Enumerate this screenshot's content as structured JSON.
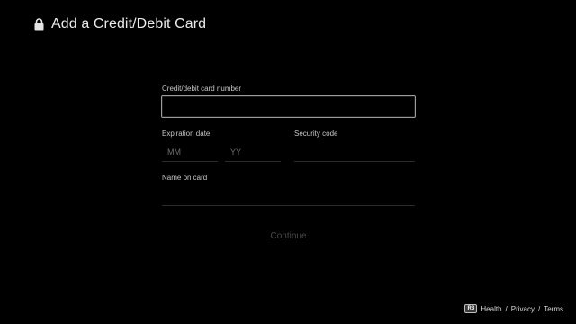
{
  "header": {
    "title": "Add a Credit/Debit Card",
    "icon": "lock-icon"
  },
  "form": {
    "card_number": {
      "label": "Credit/debit card number",
      "value": "",
      "placeholder": ""
    },
    "expiration": {
      "label": "Expiration date",
      "month_placeholder": "MM",
      "year_placeholder": "YY"
    },
    "security_code": {
      "label": "Security code",
      "placeholder": ""
    },
    "name_on_card": {
      "label": "Name on card",
      "placeholder": ""
    },
    "continue_label": "Continue"
  },
  "footer": {
    "button_icon": "R3",
    "links": [
      "Health",
      "Privacy",
      "Terms"
    ],
    "separator": " / "
  },
  "colors": {
    "background": "#000000",
    "text": "#eaeaea",
    "disabled_text": "#4a4a4a",
    "focus_border": "#9c9c9c"
  }
}
